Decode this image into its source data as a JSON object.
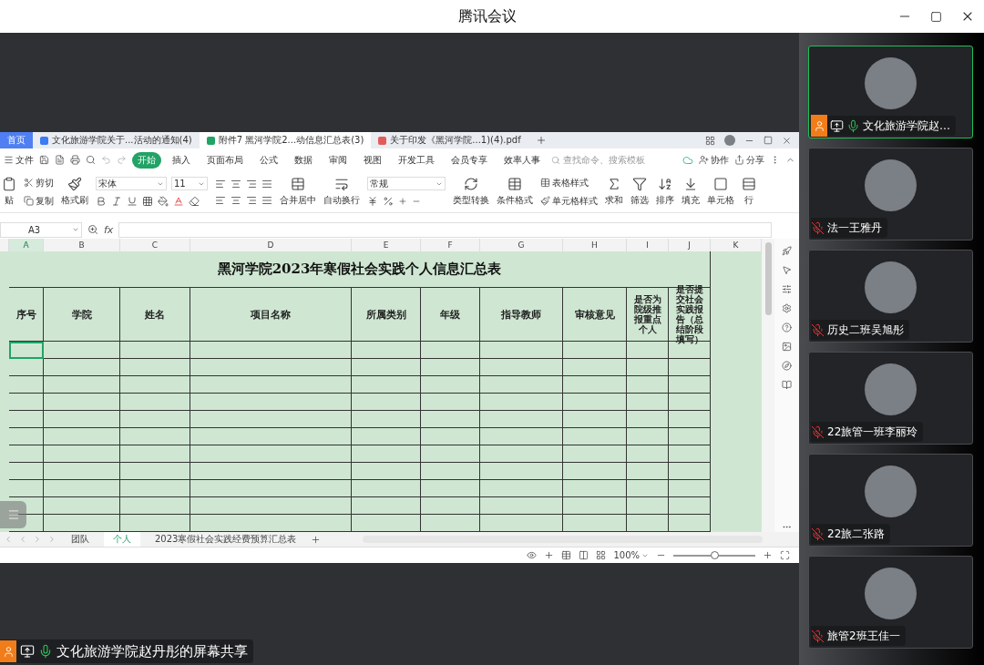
{
  "window": {
    "title": "腾讯会议"
  },
  "spreadsheet": {
    "doc_tabs": [
      {
        "label": "首页",
        "kind": "home",
        "selected": false
      },
      {
        "label": "文化旅游学院关于...活动的通知(4)",
        "kind": "doc",
        "selected": false
      },
      {
        "label": "附件7 黑河学院2...动信息汇总表(3)",
        "kind": "sheet",
        "selected": true
      },
      {
        "label": "关于印发《黑河学院...1)(4).pdf",
        "kind": "pdf",
        "selected": false
      }
    ],
    "file_menu": "文件",
    "menu_tabs": [
      {
        "label": "开始",
        "selected": true
      },
      {
        "label": "插入",
        "selected": false
      },
      {
        "label": "页面布局",
        "selected": false
      },
      {
        "label": "公式",
        "selected": false
      },
      {
        "label": "数据",
        "selected": false
      },
      {
        "label": "审阅",
        "selected": false
      },
      {
        "label": "视图",
        "selected": false
      },
      {
        "label": "开发工具",
        "selected": false
      },
      {
        "label": "会员专享",
        "selected": false
      },
      {
        "label": "效率人事",
        "selected": false
      }
    ],
    "search": {
      "placeholder": "查找命令、搜索模板"
    },
    "collaborate": "协作",
    "share": "分享",
    "ribbon": {
      "paste": "贴",
      "cut": "剪切",
      "copy": "复制",
      "format_painter": "格式刷",
      "font": "宋体",
      "font_size": "11",
      "merge": "合并居中",
      "wrap": "自动换行",
      "number_format": "常规",
      "convert": "类型转换",
      "conditional": "条件格式",
      "table_style": "表格样式",
      "cell_style": "单元格样式",
      "tools": [
        "求和",
        "筛选",
        "排序",
        "填充",
        "单元格",
        "行"
      ]
    },
    "name_box": "A3",
    "function_label": "fx",
    "columns": [
      {
        "letter": "A",
        "selected": true
      },
      {
        "letter": "B",
        "selected": false
      },
      {
        "letter": "C",
        "selected": false
      },
      {
        "letter": "D",
        "selected": false
      },
      {
        "letter": "E",
        "selected": false
      },
      {
        "letter": "F",
        "selected": false
      },
      {
        "letter": "G",
        "selected": false
      },
      {
        "letter": "H",
        "selected": false
      },
      {
        "letter": "I",
        "selected": false
      },
      {
        "letter": "J",
        "selected": false
      },
      {
        "letter": "K",
        "selected": false
      }
    ],
    "sheet_title": "黑河学院2023年寒假社会实践个人信息汇总表",
    "headers": [
      "序号",
      "学院",
      "姓名",
      "项目名称",
      "所属类别",
      "年级",
      "指导教师",
      "审核意见",
      "是否为院级推报重点个人",
      "是否提交社会实践报告（总结阶段填写）"
    ],
    "data_rows": [
      {
        "cursor": true
      },
      {
        "cursor": false
      },
      {
        "cursor": false
      },
      {
        "cursor": false
      },
      {
        "cursor": false
      },
      {
        "cursor": false
      },
      {
        "cursor": false
      },
      {
        "cursor": false
      },
      {
        "cursor": false
      },
      {
        "cursor": false
      },
      {
        "cursor": false
      }
    ],
    "sheet_tabs": [
      {
        "label": "团队",
        "selected": false
      },
      {
        "label": "个人",
        "selected": true
      },
      {
        "label": "2023寒假社会实践经费预算汇总表",
        "selected": false
      }
    ],
    "zoom": "100%",
    "zoom_slider": {
      "level": 0.5
    }
  },
  "share_label": {
    "host": true,
    "sharing": true,
    "muted": false,
    "text": "文化旅游学院赵丹彤的屏幕共享"
  },
  "participants": [
    {
      "name": "文化旅游学院赵…",
      "host": true,
      "sharing": true,
      "muted": false,
      "active": true
    },
    {
      "name": "法一王雅丹",
      "host": false,
      "sharing": false,
      "muted": true,
      "active": false
    },
    {
      "name": "历史二班吴旭彤",
      "host": false,
      "sharing": false,
      "muted": true,
      "active": false
    },
    {
      "name": "22旅管一班李丽玲",
      "host": false,
      "sharing": false,
      "muted": true,
      "active": false
    },
    {
      "name": "22旅二张路",
      "host": false,
      "sharing": false,
      "muted": true,
      "active": false
    },
    {
      "name": "旅管2班王佳一",
      "host": false,
      "sharing": false,
      "muted": true,
      "active": false
    }
  ]
}
